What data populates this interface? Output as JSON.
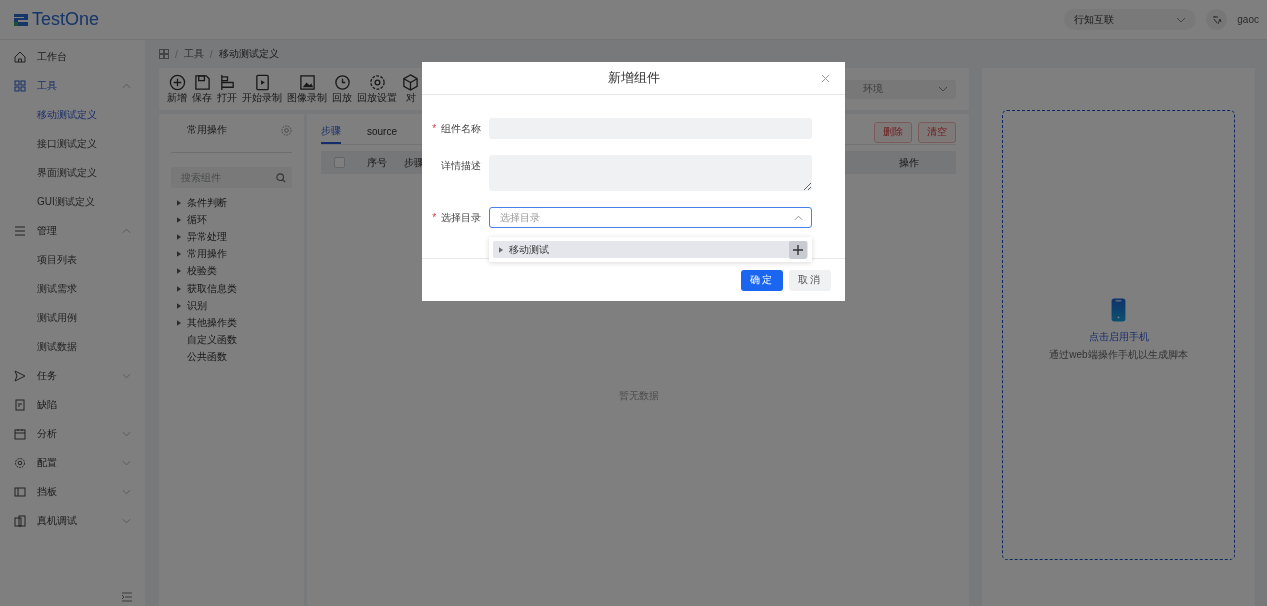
{
  "header": {
    "logo": "TestOne",
    "workspace": "行知互联",
    "user": "gaoc"
  },
  "sidebar": {
    "items": [
      {
        "label": "工作台",
        "kind": "leaf",
        "selected": false
      },
      {
        "label": "工具",
        "kind": "group",
        "expanded": true,
        "selected": true,
        "children": [
          {
            "label": "移动测试定义",
            "selected": true
          },
          {
            "label": "接口测试定义",
            "selected": false
          },
          {
            "label": "界面测试定义",
            "selected": false
          },
          {
            "label": "GUI测试定义",
            "selected": false
          }
        ]
      },
      {
        "label": "管理",
        "kind": "group",
        "expanded": true,
        "selected": false,
        "children": [
          {
            "label": "项目列表",
            "selected": false
          },
          {
            "label": "测试需求",
            "selected": false
          },
          {
            "label": "测试用例",
            "selected": false
          },
          {
            "label": "测试数据",
            "selected": false
          }
        ]
      },
      {
        "label": "任务",
        "kind": "group",
        "expanded": false,
        "selected": false
      },
      {
        "label": "缺陷",
        "kind": "leaf",
        "selected": false
      },
      {
        "label": "分析",
        "kind": "group",
        "expanded": false,
        "selected": false
      },
      {
        "label": "配置",
        "kind": "group",
        "expanded": false,
        "selected": false
      },
      {
        "label": "挡板",
        "kind": "group",
        "expanded": false,
        "selected": false
      },
      {
        "label": "真机调试",
        "kind": "group",
        "expanded": false,
        "selected": false
      }
    ]
  },
  "breadcrumb": {
    "separator": "/",
    "items": [
      "工具",
      "移动测试定义"
    ]
  },
  "toolbar": {
    "buttons": [
      {
        "label": "新增"
      },
      {
        "label": "保存"
      },
      {
        "label": "打开"
      },
      {
        "label": "开始录制"
      },
      {
        "label": "图像录制"
      },
      {
        "label": "回放"
      },
      {
        "label": "回放设置"
      },
      {
        "label": "对"
      }
    ],
    "environment": "环境"
  },
  "components": {
    "title": "常用操作",
    "search_placeholder": "搜索组件",
    "tree": [
      {
        "label": "条件判断",
        "expandable": true
      },
      {
        "label": "循环",
        "expandable": true
      },
      {
        "label": "异常处理",
        "expandable": true
      },
      {
        "label": "常用操作",
        "expandable": true
      },
      {
        "label": "校验类",
        "expandable": true
      },
      {
        "label": "获取信息类",
        "expandable": true
      },
      {
        "label": "识别",
        "expandable": true
      },
      {
        "label": "其他操作类",
        "expandable": true
      },
      {
        "label": "自定义函数",
        "expandable": false
      },
      {
        "label": "公共函数",
        "expandable": false
      }
    ]
  },
  "tabs": [
    {
      "label": "步骤",
      "selected": true
    },
    {
      "label": "source",
      "selected": false
    }
  ],
  "actions": [
    "删除",
    "清空"
  ],
  "table": {
    "select_all_checked": false,
    "columns": [
      "序号",
      "步骤",
      "操作"
    ],
    "empty_text": "暂无数据"
  },
  "phone_panel": {
    "title": "点击启用手机",
    "hint": "通过web端操作手机以生成脚本"
  },
  "dialog": {
    "title": "新增组件",
    "required_mark": "*",
    "fields": [
      {
        "label": "组件名称",
        "required": true,
        "kind": "input"
      },
      {
        "label": "详情描述",
        "required": false,
        "kind": "textarea"
      },
      {
        "label": "选择目录",
        "required": true,
        "kind": "select",
        "placeholder": "选择目录",
        "expanded": true
      }
    ],
    "dropdown": [
      {
        "label": "移动测试",
        "expandable": true
      }
    ],
    "buttons": [
      {
        "label": "确定",
        "primary": true
      },
      {
        "label": "取消",
        "primary": false
      }
    ]
  }
}
